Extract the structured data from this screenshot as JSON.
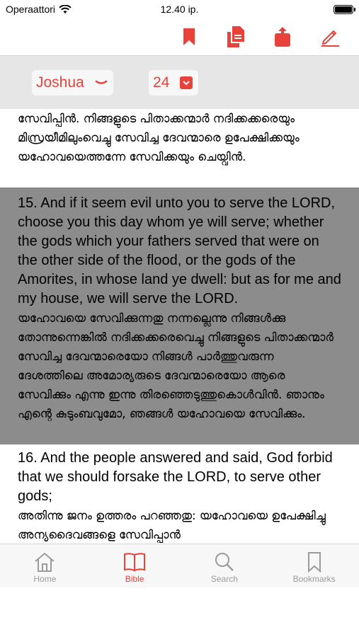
{
  "status": {
    "carrier": "Operaattori",
    "time": "12.40 ip."
  },
  "toolbar": {
    "accent": "#e8423b",
    "icons": [
      "bookmark-icon",
      "copy-icon",
      "share-icon",
      "edit-icon"
    ]
  },
  "selector": {
    "book": "Joshua",
    "chapter": "24"
  },
  "verses": {
    "prev": {
      "ml": "സേവിപ്പിൻ. നിങ്ങളുടെ പിതാക്കന്മാർ നദിക്കക്കരെയും മിസ്രയീമിലുംവെച്ചു സേവിച്ച ദേവന്മാരെ ഉപേക്ഷിക്കയും യഹോവയെത്തന്നേ സേവിക്കയും ചെയ്വിൻ."
    },
    "selected": {
      "en": "15. And if it seem evil unto you to serve the LORD, choose you this day whom ye will serve; whether the gods which your fathers served that were on the other side of the flood, or the gods of the Amorites, in whose land ye dwell: but as for me and my house, we will serve the LORD.",
      "ml": "യഹോവയെ സേവിക്കുന്നതു നന്നല്ലെന്നു നിങ്ങൾക്കു തോന്നുന്നെങ്കിൽ നദിക്കക്കരെവെച്ചു നിങ്ങളുടെ പിതാക്കന്മാർ സേവിച്ച ദേവന്മാരെയോ നിങ്ങൾ പാർത്തുവരുന്ന ദേശത്തിലെ അമോര്യരുടെ ദേവന്മാരെയോ ആരെ സേവിക്കും എന്നു ഇന്നു തിരഞ്ഞെടുത്തുകൊൾവിൻ. ഞാനും എന്റെ കുടുംബവുമോ, ഞങ്ങൾ യഹോവയെ സേവിക്കും."
    },
    "next": {
      "en": "16. And the people answered and said, God forbid that we should forsake the LORD, to serve other gods;",
      "ml": "അതിന്നു ജനം ഉത്തരം പറഞ്ഞതു: യഹോവയെ ഉപേക്ഷിച്ചു അന്യദൈവങ്ങളെ സേവിപ്പാൻ"
    }
  },
  "tabs": [
    {
      "label": "Home",
      "icon": "home-icon"
    },
    {
      "label": "Bible",
      "icon": "book-icon",
      "active": true
    },
    {
      "label": "Search",
      "icon": "search-icon"
    },
    {
      "label": "Bookmarks",
      "icon": "bookmark-icon"
    }
  ]
}
